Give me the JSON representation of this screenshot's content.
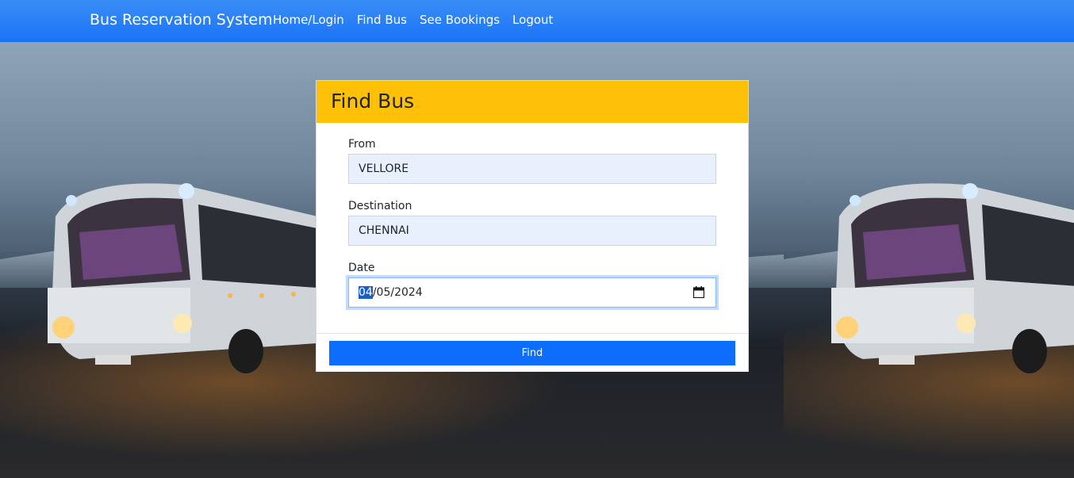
{
  "navbar": {
    "brand": "Bus Reservation System",
    "links": [
      "Home/Login",
      "Find Bus",
      "See Bookings",
      "Logout"
    ]
  },
  "form": {
    "title": "Find Bus",
    "from": {
      "label": "From",
      "value": "VELLORE"
    },
    "destination": {
      "label": "Destination",
      "value": "CHENNAI"
    },
    "date": {
      "label": "Date",
      "day": "04",
      "rest": "/05/2024"
    },
    "submit_label": "Find"
  },
  "colors": {
    "navbar": "#1a73f5",
    "card_header": "#ffc107",
    "button": "#0d6efd",
    "input_autofill": "#e8f0fe"
  },
  "icons": {
    "date_picker": "calendar-icon"
  }
}
